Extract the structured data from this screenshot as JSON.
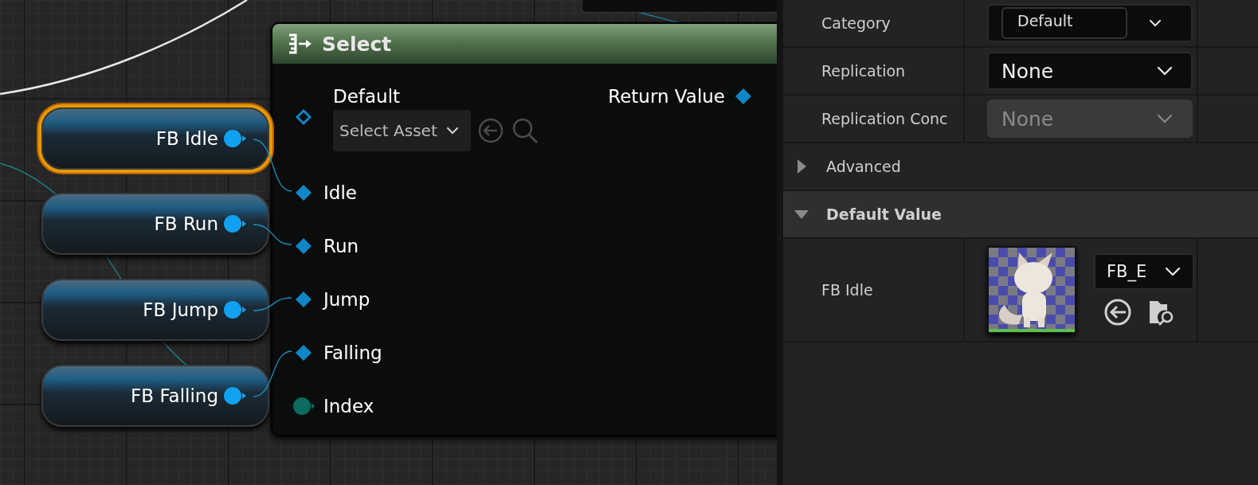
{
  "graph": {
    "variable_nodes": [
      {
        "label": "FB Idle",
        "selected": true
      },
      {
        "label": "FB Run",
        "selected": false
      },
      {
        "label": "FB Jump",
        "selected": false
      },
      {
        "label": "FB Falling",
        "selected": false
      }
    ],
    "select_node": {
      "title": "Select",
      "default_pin": {
        "label": "Default",
        "connected": false,
        "picker": "Select Asset"
      },
      "output_pin": {
        "label": "Return Value",
        "connected": true
      },
      "pins": [
        {
          "kind": "option",
          "label": "Idle",
          "connected": true
        },
        {
          "kind": "option",
          "label": "Run",
          "connected": true
        },
        {
          "kind": "option",
          "label": "Jump",
          "connected": true
        },
        {
          "kind": "option",
          "label": "Falling",
          "connected": true
        },
        {
          "kind": "index",
          "label": "Index",
          "connected": true
        }
      ]
    }
  },
  "details": {
    "rows": [
      {
        "kind": "combo",
        "label": "Category",
        "value": "Default"
      },
      {
        "kind": "dropdown",
        "label": "Replication",
        "value": "None",
        "disabled": false
      },
      {
        "kind": "dropdown",
        "label": "Replication Conc",
        "value": "None",
        "disabled": true
      },
      {
        "kind": "section",
        "label": "Advanced",
        "expanded": false
      },
      {
        "kind": "section",
        "label": "Default Value",
        "expanded": true
      },
      {
        "kind": "asset",
        "label": "FB Idle",
        "value": "FB_E"
      }
    ]
  }
}
